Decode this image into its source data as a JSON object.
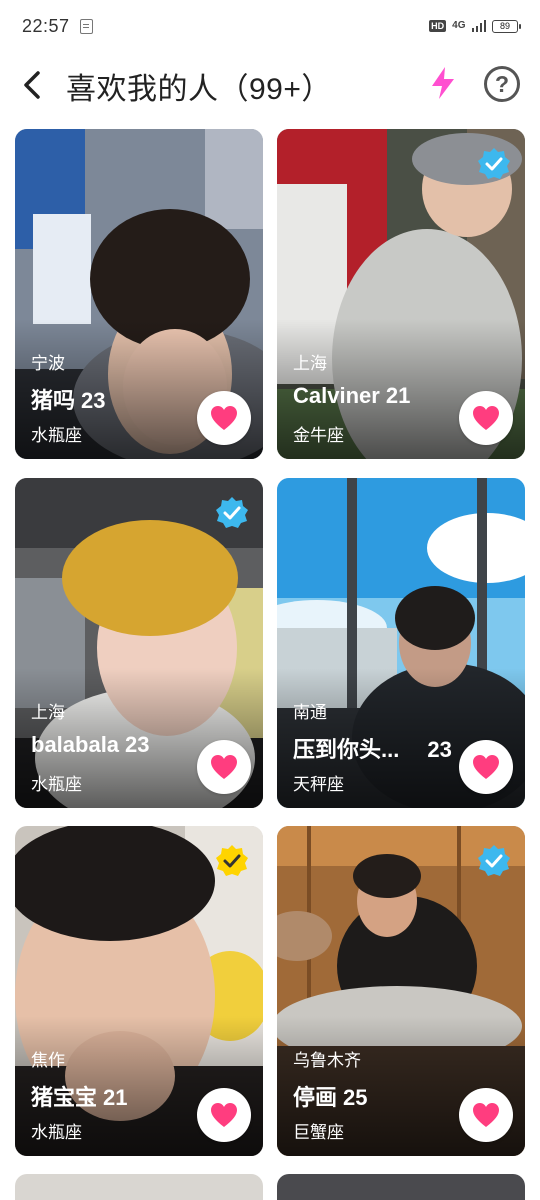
{
  "status": {
    "time": "22:57",
    "hd": "HD",
    "network": "4G",
    "battery": "89"
  },
  "header": {
    "title": "喜欢我的人（99+）",
    "help_glyph": "?"
  },
  "colors": {
    "like_heart": "#ff3d7f",
    "bolt": "#ff4fd0",
    "verified_blue": "#3db8ee",
    "verified_gold": "#ffd400"
  },
  "cards": [
    {
      "location": "宁波",
      "name": "猪吗",
      "age": "23",
      "zodiac": "水瓶座",
      "badge": "none"
    },
    {
      "location": "上海",
      "name": "Calviner",
      "age": "21",
      "zodiac": "金牛座",
      "badge": "verified-blue"
    },
    {
      "location": "上海",
      "name": "balabala",
      "age": "23",
      "zodiac": "水瓶座",
      "badge": "verified-blue"
    },
    {
      "location": "南通",
      "name": "压到你头...",
      "age": "23",
      "zodiac": "天秤座",
      "badge": "none"
    },
    {
      "location": "焦作",
      "name": "猪宝宝",
      "age": "21",
      "zodiac": "水瓶座",
      "badge": "verified-gold"
    },
    {
      "location": "乌鲁木齐",
      "name": "停画",
      "age": "25",
      "zodiac": "巨蟹座",
      "badge": "verified-blue"
    }
  ]
}
